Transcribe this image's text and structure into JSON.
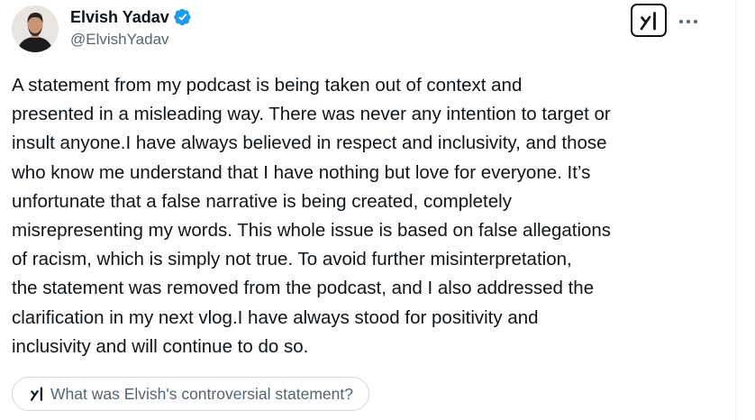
{
  "author": {
    "display_name": "Elvish Yadav",
    "handle": "@ElvishYadav",
    "verified": true,
    "verified_color": "#1d9bf0"
  },
  "header": {
    "grok_icon": "grok-logo-icon",
    "more_icon": "more-horizontal-icon"
  },
  "tweet": {
    "text": "A statement from my podcast is being taken out of context and\npresented in a misleading way. There was never any intention to target or\ninsult anyone.I have always believed in respect and inclusivity, and those\nwho know me understand that I have nothing but love for everyone. It’s\nunfortunate that a false narrative is being created, completely\nmisrepresenting my words. This whole issue is based on false allegations\nof racism, which is simply not true. To avoid further misinterpretation,\nthe statement was removed from the podcast, and I also addressed the\nclarification in my next vlog.I have always stood for positivity and\ninclusivity and will continue to do so."
  },
  "grok_prompt": {
    "label": "What was Elvish's controversial statement?",
    "icon": "grok-logo-icon"
  },
  "colors": {
    "text_primary": "#0f1419",
    "text_secondary": "#536471",
    "border": "#cfd9de"
  }
}
